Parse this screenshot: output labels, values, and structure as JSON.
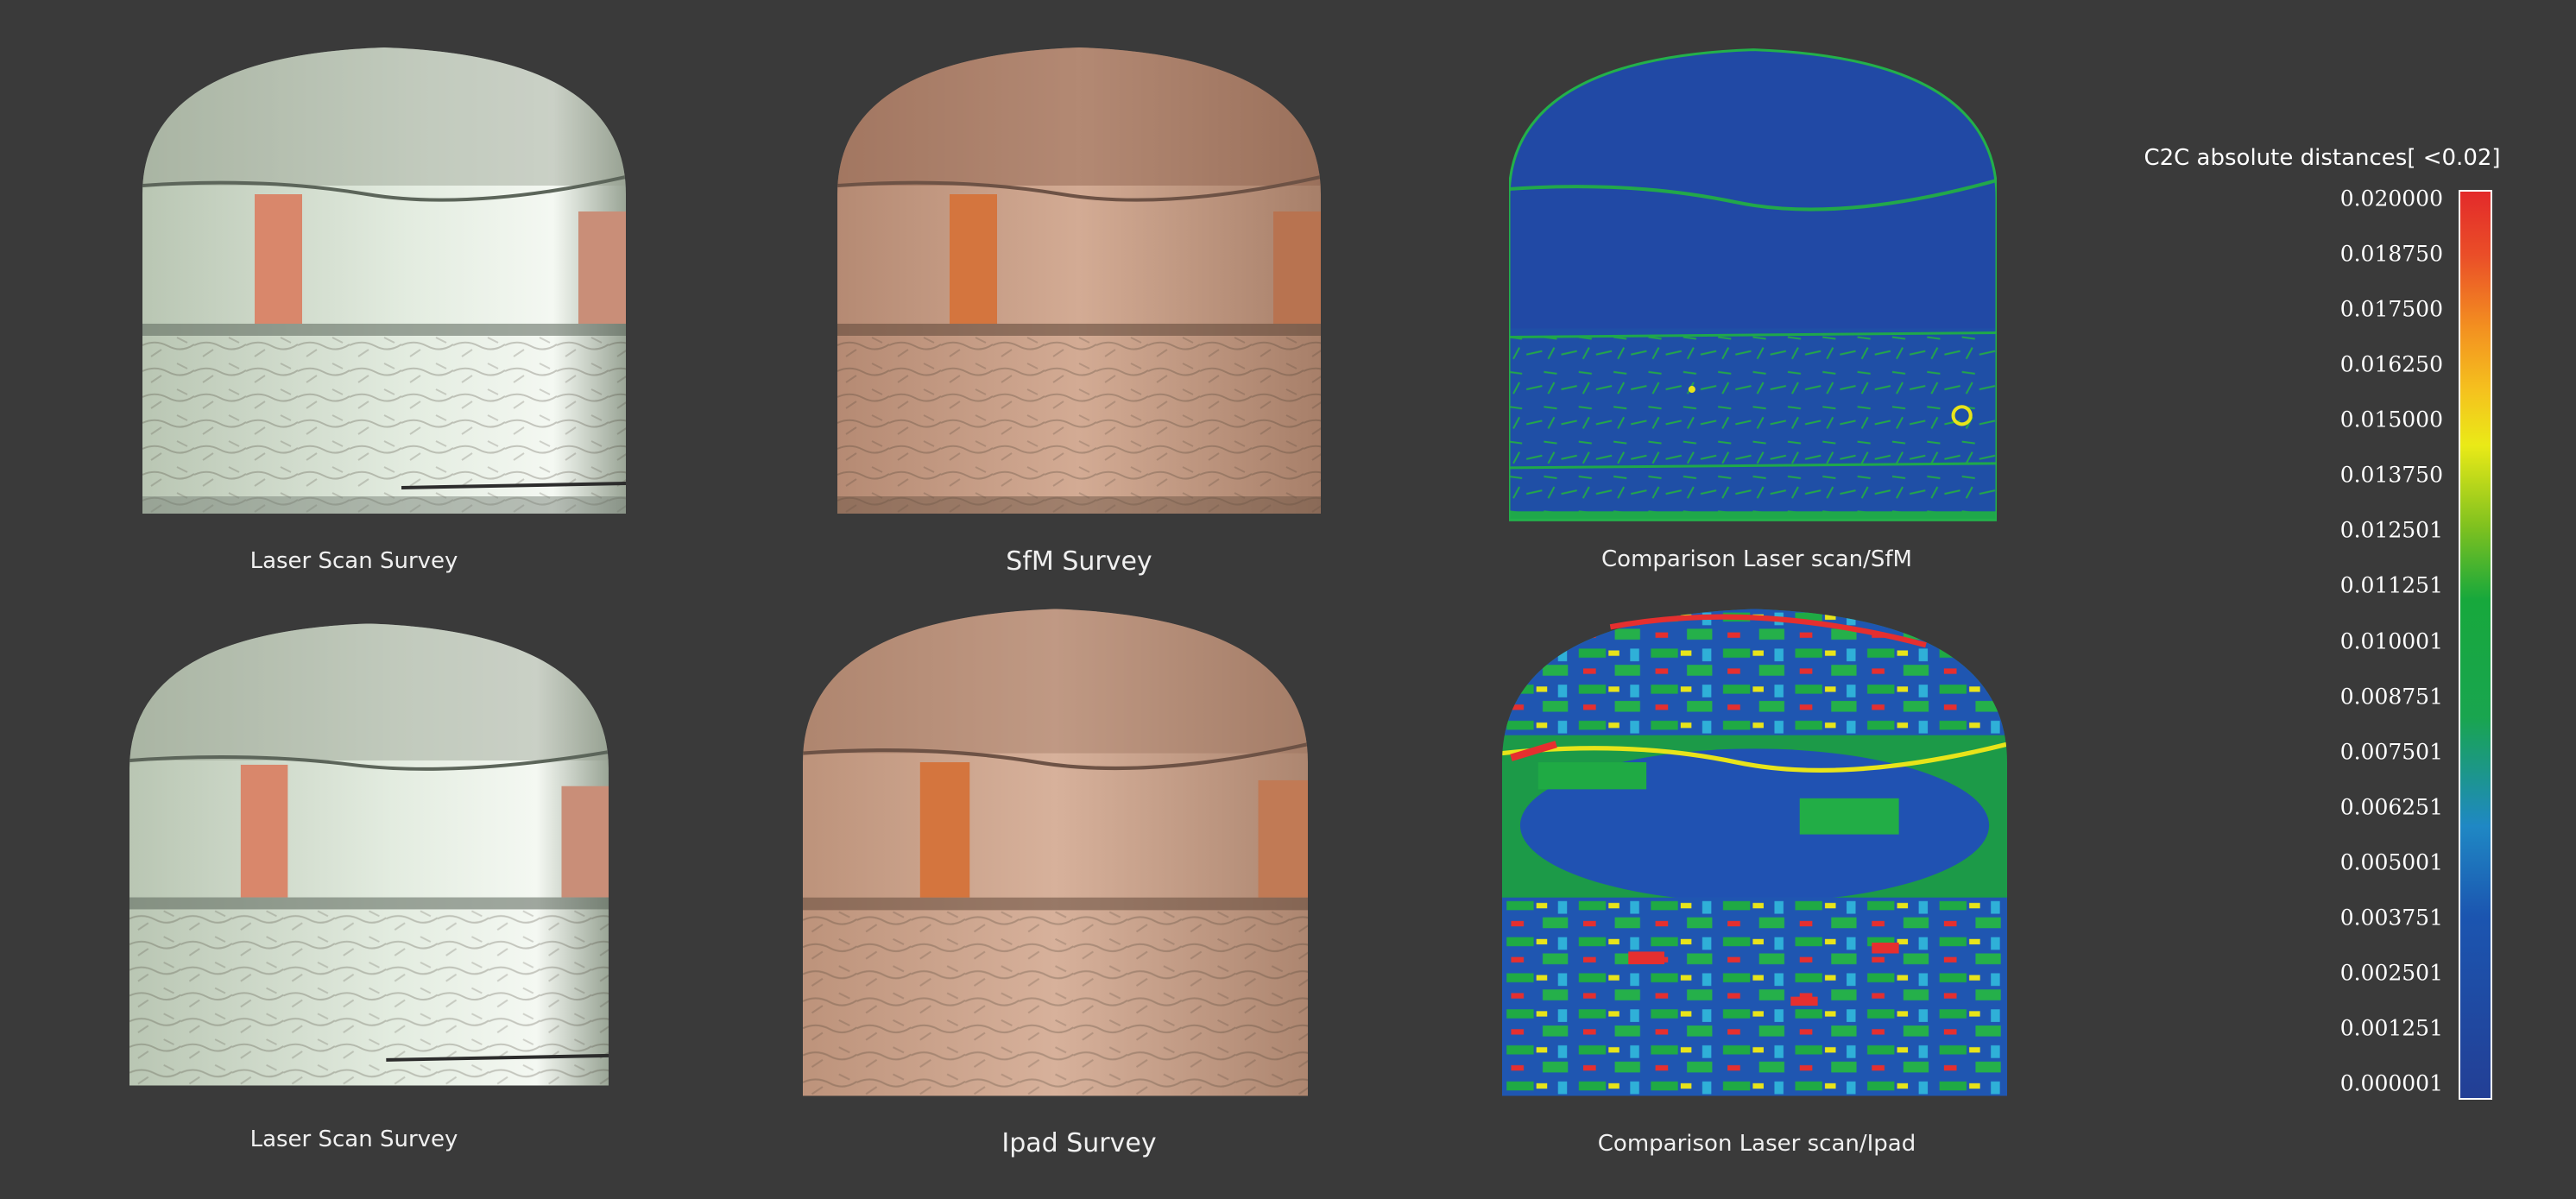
{
  "panels": {
    "laser_top": {
      "caption": "Laser Scan Survey"
    },
    "sfm": {
      "caption": "SfM Survey"
    },
    "comparison_sfm": {
      "caption": "Comparison Laser scan/SfM"
    },
    "laser_bottom": {
      "caption": "Laser Scan Survey"
    },
    "ipad": {
      "caption": "Ipad Survey"
    },
    "comparison_ipad": {
      "caption": "Comparison Laser scan/Ipad"
    }
  },
  "legend": {
    "title": "C2C absolute distances[ <0.02]",
    "ticks": [
      "0.020000",
      "0.018750",
      "0.017500",
      "0.016250",
      "0.015000",
      "0.013750",
      "0.012501",
      "0.011251",
      "0.010001",
      "0.008751",
      "0.007501",
      "0.006251",
      "0.005001",
      "0.003751",
      "0.002501",
      "0.001251",
      "0.000001"
    ]
  },
  "colors": {
    "background": "#3a3a3a",
    "laser_wall": "#cfd9cc",
    "sfm_wall": "#c79a84",
    "ipad_wall": "#c9a08a",
    "accent_red_panel": "#d9764f",
    "scale_low": "#233f95",
    "scale_mid": "#17a83c",
    "scale_high": "#e32a2a"
  }
}
